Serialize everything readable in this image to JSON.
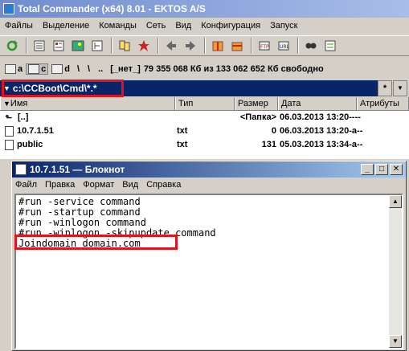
{
  "window": {
    "title": "Total Commander (x64) 8.01 - EKTOS A/S"
  },
  "menu": [
    "Файлы",
    "Выделение",
    "Команды",
    "Сеть",
    "Вид",
    "Конфигурация",
    "Запуск"
  ],
  "toolbar_icons": [
    "refresh-icon",
    "brief-view-icon",
    "full-view-icon",
    "thumbnail-icon",
    "tree-icon",
    "compare-icon",
    "select-icon",
    "back-icon",
    "forward-icon",
    "pack-icon",
    "unpack-icon",
    "ftp-icon",
    "url-icon",
    "find-icon",
    "multi-rename-icon"
  ],
  "drives": {
    "a": "a",
    "c": "c",
    "d": "d",
    "root": "\\",
    "up": "..",
    "label": "[_нет_]",
    "free_info": "79 355 068 Кб из 133 062 652 Кб свободно"
  },
  "path": {
    "value": "c:\\CCBoot\\Cmd\\*.*",
    "btn_star": "*",
    "btn_down": "▼"
  },
  "columns": {
    "name": "Имя",
    "ext": "Тип",
    "size": "Размер",
    "date": "Дата",
    "attr": "Атрибуты"
  },
  "files": [
    {
      "name": "[..]",
      "ext": "",
      "size": "<Папка>",
      "date": "06.03.2013 13:20----"
    },
    {
      "name": "10.7.1.51",
      "ext": "txt",
      "size": "0",
      "date": "06.03.2013 13:20-a--"
    },
    {
      "name": "public",
      "ext": "txt",
      "size": "131",
      "date": "05.03.2013 13:34-a--"
    }
  ],
  "notepad": {
    "title": "10.7.1.51 — Блокнот",
    "menu": [
      "Файл",
      "Правка",
      "Формат",
      "Вид",
      "Справка"
    ],
    "content": "#run -service command\n#run -startup command\n#run -winlogon command\n#run -winlogon -skipupdate command\nJoindomain domain.com"
  },
  "colors": {
    "highlight": "#e0141a",
    "path_bg": "#0a246a"
  }
}
